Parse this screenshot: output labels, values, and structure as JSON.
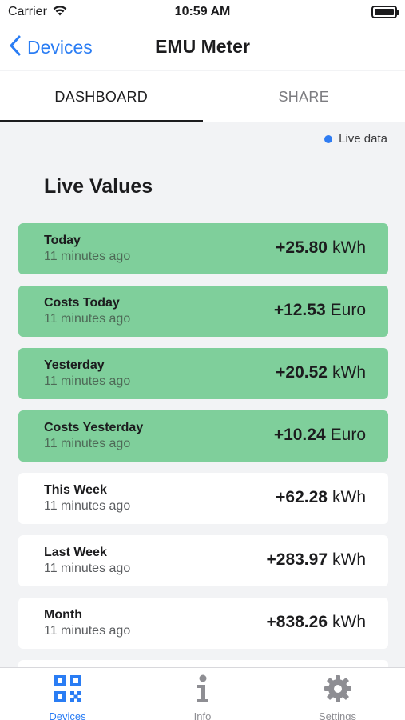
{
  "status_bar": {
    "carrier": "Carrier",
    "time": "10:59 AM"
  },
  "nav": {
    "back_label": "Devices",
    "title": "EMU Meter"
  },
  "tabs": [
    {
      "label": "DASHBOARD",
      "active": true
    },
    {
      "label": "SHARE",
      "active": false
    }
  ],
  "live_indicator": {
    "label": "Live data",
    "dot_color": "#2f7cf2"
  },
  "section_title": "Live Values",
  "cards": [
    {
      "name": "Today",
      "time": "11 minutes ago",
      "value": "+25.80",
      "unit": "kWh",
      "highlight": true
    },
    {
      "name": "Costs Today",
      "time": "11 minutes ago",
      "value": "+12.53",
      "unit": "Euro",
      "highlight": true
    },
    {
      "name": "Yesterday",
      "time": "11 minutes ago",
      "value": "+20.52",
      "unit": "kWh",
      "highlight": true
    },
    {
      "name": "Costs Yesterday",
      "time": "11 minutes ago",
      "value": "+10.24",
      "unit": "Euro",
      "highlight": true
    },
    {
      "name": "This Week",
      "time": "11 minutes ago",
      "value": "+62.28",
      "unit": "kWh",
      "highlight": false
    },
    {
      "name": "Last Week",
      "time": "11 minutes ago",
      "value": "+283.97",
      "unit": "kWh",
      "highlight": false
    },
    {
      "name": "Month",
      "time": "11 minutes ago",
      "value": "+838.26",
      "unit": "kWh",
      "highlight": false
    }
  ],
  "colors": {
    "accent": "#2a7df4",
    "highlight_card": "#7fcf9b"
  },
  "tab_bar": [
    {
      "label": "Devices",
      "icon": "qr-code-icon",
      "selected": true
    },
    {
      "label": "Info",
      "icon": "info-icon",
      "selected": false
    },
    {
      "label": "Settings",
      "icon": "gear-icon",
      "selected": false
    }
  ]
}
